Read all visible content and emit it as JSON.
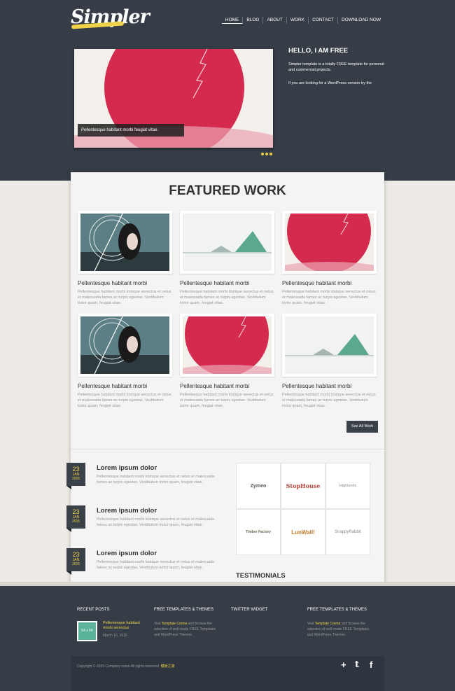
{
  "header": {
    "logo": "Simpler",
    "nav": [
      "HOME",
      "BLOG",
      "ABOUT",
      "WORK",
      "CONTACT",
      "DOWNLOAD NOW"
    ],
    "active_nav": "HOME"
  },
  "hero": {
    "caption": "Pellentesque habitant morbi feugiat vitae.",
    "title": "HELLO, I AM FREE",
    "text1": "Simpler template is a totally FREE template for personal and commercial projects.",
    "text2": "If you are looking for a WordPress version try the"
  },
  "featured": {
    "title": "FEATURED WORK",
    "items": [
      {
        "title": "Pellentesque habitant morbi",
        "desc": "Pellentesque habitant morbi tristique senectus et netus et malesuada fames ac turpis egestas. Vestibulum tortor quam, feugiat vitae."
      },
      {
        "title": "Pellentesque habitant morbi",
        "desc": "Pellentesque habitant morbi tristique senectus et netus et malesuada fames ac turpis egestas. Vestibulum tortor quam, feugiat vitae."
      },
      {
        "title": "Pellentesque habitant morbi",
        "desc": "Pellentesque habitant morbi tristique senectus et netus et malesuada fames ac turpis egestas. Vestibulum tortor quam, feugiat vitae."
      },
      {
        "title": "Pellentesque habitant morbi",
        "desc": "Pellentesque habitant morbi tristique senectus et netus et malesuada fames ac turpis egestas. Vestibulum tortor quam, feugiat vitae."
      },
      {
        "title": "Pellentesque habitant morbi",
        "desc": "Pellentesque habitant morbi tristique senectus et netus et malesuada fames ac turpis egestas. Vestibulum tortor quam, feugiat vitae."
      },
      {
        "title": "Pellentesque habitant morbi",
        "desc": "Pellentesque habitant morbi tristique senectus et netus et malesuada fames ac turpis egestas. Vestibulum tortor quam, feugiat vitae."
      }
    ],
    "see_all": "See All Work"
  },
  "posts": [
    {
      "day": "23",
      "month": "JAN",
      "year": "2015",
      "title": "Lorem ipsum dolor",
      "text": "Pellentesque habitant morbi tristique senectus et netus et malesuada fames ac turpis egestas. Vestibulum tortor quam, feugiat vitae."
    },
    {
      "day": "23",
      "month": "JAN",
      "year": "2015",
      "title": "Lorem ipsum dolor",
      "text": "Pellentesque habitant morbi tristique senectus et netus et malesuada fames ac turpis egestas. Vestibulum tortor quam, feugiat vitae."
    },
    {
      "day": "23",
      "month": "JAN",
      "year": "2015",
      "title": "Lorem ipsum dolor",
      "text": "Pellentesque habitant morbi tristique senectus et netus et malesuada fames ac turpis egestas. Vestibulum tortor quam, feugiat vitae."
    }
  ],
  "client_logos": [
    "Zymeo",
    "StopHouse",
    "Highlands",
    "Timber Factory",
    "LunWall!",
    "SnappyRabbit"
  ],
  "testimonials_title": "TESTIMONIALS",
  "footer": {
    "recent_posts_title": "RECENT POSTS",
    "templates_title_1": "FREE TEMPLATES & THEMES",
    "twitter_title": "TWITTER WIDGET",
    "templates_title_2": "FREE TEMPLATES & THEMES",
    "thumb_label": "54 x 54",
    "recent_link": "Pellentesque habitant morbi senectus",
    "recent_date": "March 10, 2015",
    "visit": "Visit",
    "templates_link": "Template Creme",
    "templates_text": "and browse the selection of well-made FREE Templates and WordPress Themes.",
    "copyright": "Copyright © 2015 Company name All rights reserved.",
    "copyright_link": "模板之家",
    "social": {
      "plus": "+",
      "twitter": "t",
      "facebook": "f"
    }
  },
  "colors": {
    "dark": "#363d47",
    "accent": "#f0d24a",
    "crimson": "#d42a4d",
    "teal": "#5aa890"
  }
}
